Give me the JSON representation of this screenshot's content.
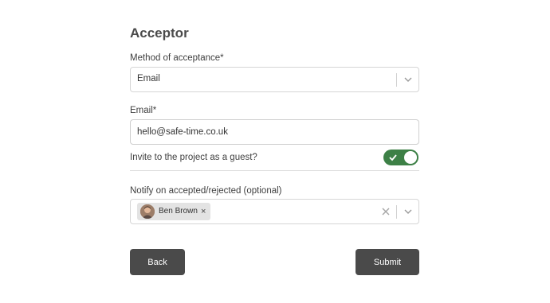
{
  "form": {
    "title": "Acceptor",
    "method_label": "Method of acceptance*",
    "method_value": "Email",
    "email_label": "Email*",
    "email_value": "hello@safe-time.co.uk",
    "guest_label": "Invite to the project as a guest?",
    "guest_enabled": true,
    "notify_label": "Notify on accepted/rejected (optional)",
    "notify_selected": [
      {
        "name": "Ben Brown",
        "remove": "×"
      }
    ],
    "back_label": "Back",
    "submit_label": "Submit"
  },
  "colors": {
    "toggle_on": "#3d8046",
    "button_bg": "#4a4a4a",
    "chip_bg": "#e3e3e3"
  },
  "icons": [
    "chevron-down-icon",
    "close-icon",
    "check-icon",
    "avatar"
  ]
}
